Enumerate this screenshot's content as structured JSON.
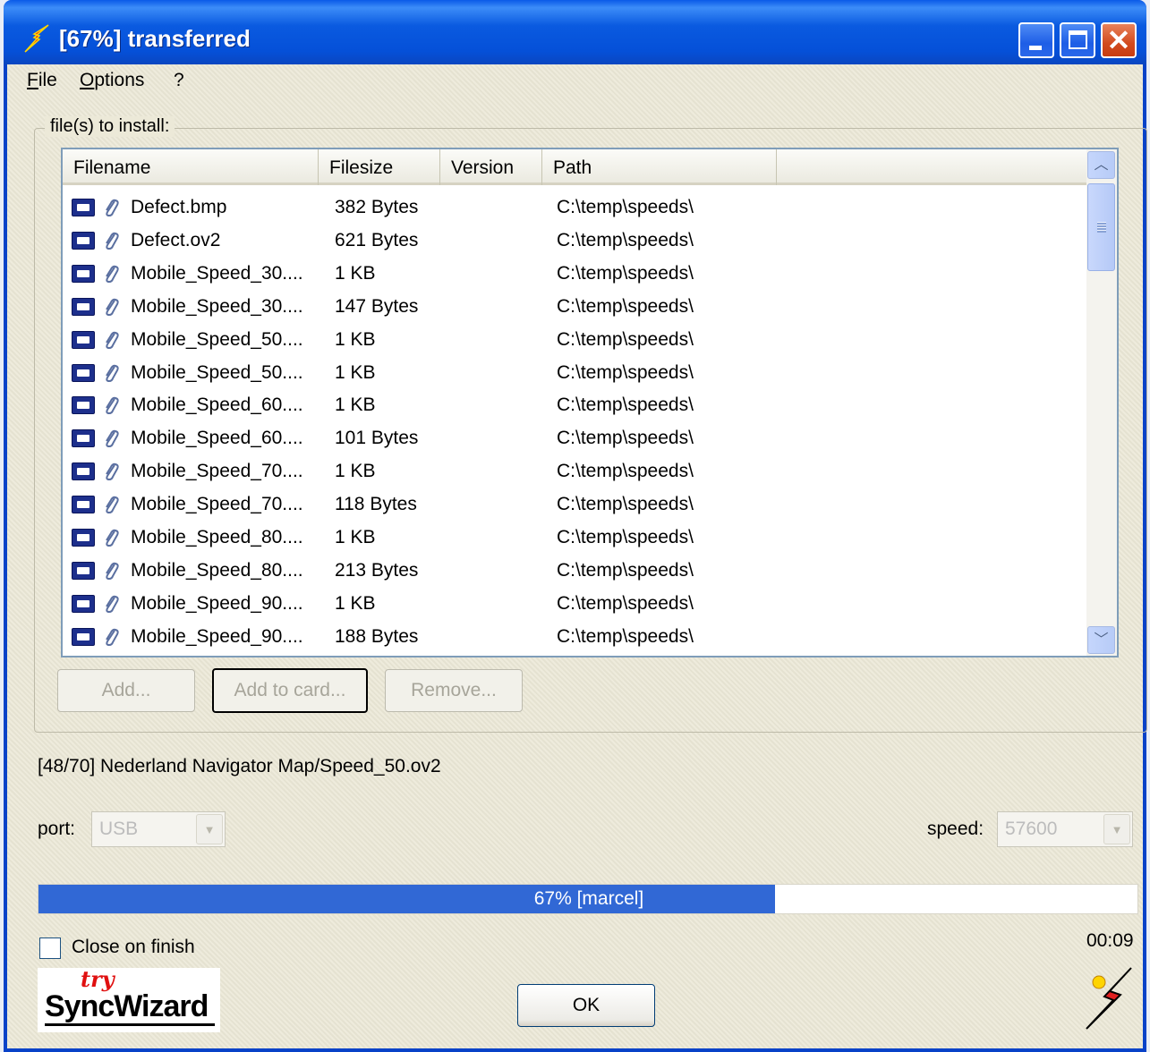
{
  "window": {
    "title": "[67%] transferred"
  },
  "menu": {
    "items": [
      {
        "label": "File",
        "accel_first": "F",
        "accel_rest": "ile"
      },
      {
        "label": "Options",
        "accel_first": "O",
        "accel_rest": "ptions"
      },
      {
        "label": "?",
        "accel_first": "",
        "accel_rest": "?"
      }
    ]
  },
  "files_group": {
    "label": "file(s) to install:"
  },
  "listview": {
    "columns": [
      "Filename",
      "Filesize",
      "Version",
      "Path"
    ],
    "rows": [
      {
        "filename": "Defect.bmp",
        "filesize": "382 Bytes",
        "version": "",
        "path": "C:\\temp\\speeds\\"
      },
      {
        "filename": "Defect.ov2",
        "filesize": "621 Bytes",
        "version": "",
        "path": "C:\\temp\\speeds\\"
      },
      {
        "filename": "Mobile_Speed_30....",
        "filesize": "1 KB",
        "version": "",
        "path": "C:\\temp\\speeds\\"
      },
      {
        "filename": "Mobile_Speed_30....",
        "filesize": "147 Bytes",
        "version": "",
        "path": "C:\\temp\\speeds\\"
      },
      {
        "filename": "Mobile_Speed_50....",
        "filesize": "1 KB",
        "version": "",
        "path": "C:\\temp\\speeds\\"
      },
      {
        "filename": "Mobile_Speed_50....",
        "filesize": "1 KB",
        "version": "",
        "path": "C:\\temp\\speeds\\"
      },
      {
        "filename": "Mobile_Speed_60....",
        "filesize": "1 KB",
        "version": "",
        "path": "C:\\temp\\speeds\\"
      },
      {
        "filename": "Mobile_Speed_60....",
        "filesize": "101 Bytes",
        "version": "",
        "path": "C:\\temp\\speeds\\"
      },
      {
        "filename": "Mobile_Speed_70....",
        "filesize": "1 KB",
        "version": "",
        "path": "C:\\temp\\speeds\\"
      },
      {
        "filename": "Mobile_Speed_70....",
        "filesize": "118 Bytes",
        "version": "",
        "path": "C:\\temp\\speeds\\"
      },
      {
        "filename": "Mobile_Speed_80....",
        "filesize": "1 KB",
        "version": "",
        "path": "C:\\temp\\speeds\\"
      },
      {
        "filename": "Mobile_Speed_80....",
        "filesize": "213 Bytes",
        "version": "",
        "path": "C:\\temp\\speeds\\"
      },
      {
        "filename": "Mobile_Speed_90....",
        "filesize": "1 KB",
        "version": "",
        "path": "C:\\temp\\speeds\\"
      },
      {
        "filename": "Mobile_Speed_90....",
        "filesize": "188 Bytes",
        "version": "",
        "path": "C:\\temp\\speeds\\"
      }
    ],
    "row_icons": [
      "memory-card-icon",
      "paperclip-icon"
    ]
  },
  "buttons": {
    "add": "Add...",
    "add_to_card": "Add to card...",
    "remove": "Remove...",
    "ok": "OK"
  },
  "status": {
    "current_file": "[48/70] Nederland Navigator Map/Speed_50.ov2"
  },
  "port": {
    "label": "port:",
    "value": "USB"
  },
  "speed": {
    "label": "speed:",
    "value": "57600"
  },
  "progress": {
    "percent": 67,
    "text": "67% [marcel]",
    "fill_color": "#3168d5"
  },
  "options": {
    "close_on_finish_label": "Close on finish",
    "close_on_finish_checked": false
  },
  "timer": "00:09",
  "logo": {
    "try": "try",
    "name": "SyncWizard"
  },
  "colors": {
    "titlebar": "#0a5ae0",
    "window_bg": "#ece9d8",
    "close_button": "#d24a1e"
  }
}
